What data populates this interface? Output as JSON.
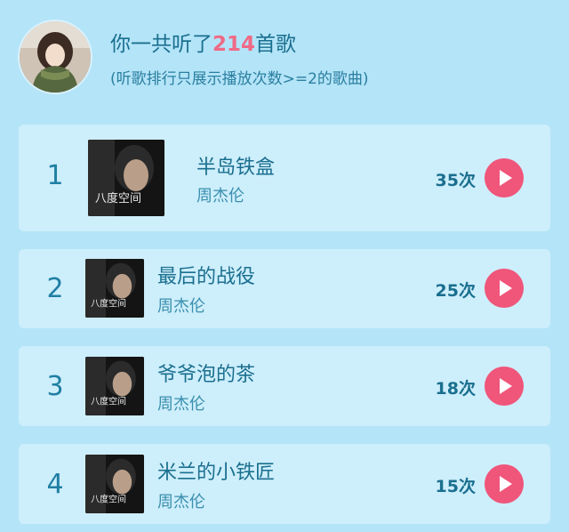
{
  "header": {
    "summary_prefix": "你一共听了",
    "total_songs": "214",
    "summary_suffix": "首歌",
    "note": "(听歌排行只展示播放次数>=2的歌曲)",
    "avatar_icon": "user-avatar"
  },
  "colors": {
    "background": "#b4e4f8",
    "card": "#cdeefb",
    "accent": "#ef6a86",
    "play_button": "#f0557a",
    "text": "#1a6f8f"
  },
  "songs": [
    {
      "rank": "1",
      "title": "半岛铁盒",
      "artist": "周杰伦",
      "plays": "35次",
      "icon": "play-icon"
    },
    {
      "rank": "2",
      "title": "最后的战役",
      "artist": "周杰伦",
      "plays": "25次",
      "icon": "play-icon"
    },
    {
      "rank": "3",
      "title": "爷爷泡的茶",
      "artist": "周杰伦",
      "plays": "18次",
      "icon": "play-icon"
    },
    {
      "rank": "4",
      "title": "米兰的小铁匠",
      "artist": "周杰伦",
      "plays": "15次",
      "icon": "play-icon"
    }
  ]
}
